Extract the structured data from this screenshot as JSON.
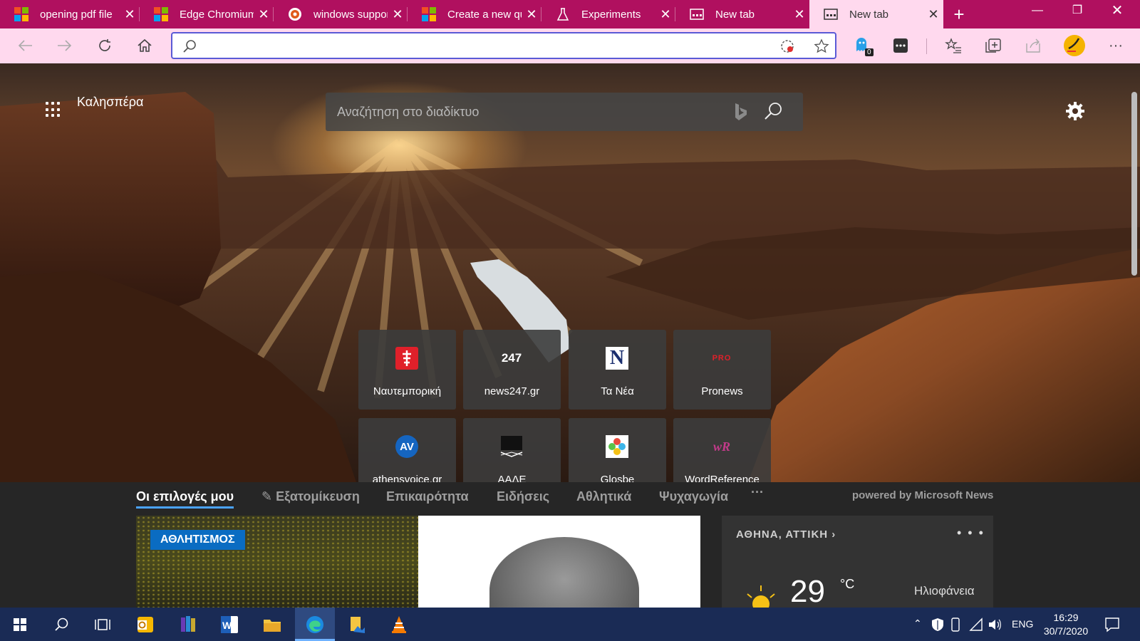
{
  "browser": {
    "tabs": [
      {
        "title": "opening pdf file",
        "icon": "microsoft-logo"
      },
      {
        "title": "Edge Chromium",
        "icon": "microsoft-logo"
      },
      {
        "title": "windows support",
        "icon": "support-site-icon"
      },
      {
        "title": "Create a new qu",
        "icon": "microsoft-logo"
      },
      {
        "title": "Experiments",
        "icon": "flask-icon"
      },
      {
        "title": "New tab",
        "icon": "newtab-icon"
      },
      {
        "title": "New tab",
        "icon": "newtab-icon",
        "active": true
      }
    ],
    "address": {
      "value": "",
      "placeholder": ""
    },
    "extension_badge": "0",
    "accent_color": "#b0105f",
    "toolbar_color": "#ffd9ee"
  },
  "ntp": {
    "greeting": "Καλησπέρα",
    "search_placeholder": "Αναζήτηση στο διαδίκτυο",
    "quick_links": [
      {
        "label": "Ναυτεμπορική",
        "icon": "naftemporiki-icon"
      },
      {
        "label": "news247.gr",
        "icon": "news247-icon",
        "icon_text": "247"
      },
      {
        "label": "Τα Νέα",
        "icon": "tanea-icon",
        "icon_text": "N"
      },
      {
        "label": "Pronews",
        "icon": "pronews-icon",
        "icon_text": "PRO"
      },
      {
        "label": "athensvoice.gr",
        "icon": "athensvoice-icon",
        "icon_text": "AV"
      },
      {
        "label": "ΑΑΔΕ",
        "icon": "aade-icon"
      },
      {
        "label": "Glosbe",
        "icon": "glosbe-icon"
      },
      {
        "label": "WordReference",
        "icon": "wordreference-icon",
        "icon_text": "wR"
      }
    ],
    "news_tabs": [
      {
        "label": "Οι επιλογές μου",
        "active": true
      },
      {
        "label": "Εξατομίκευση"
      },
      {
        "label": "Επικαιρότητα"
      },
      {
        "label": "Ειδήσεις"
      },
      {
        "label": "Αθλητικά"
      },
      {
        "label": "Ψυχαγωγία"
      },
      {
        "label": "···"
      }
    ],
    "powered_by": "powered by Microsoft News",
    "card_badge": "ΑΘΛΗΤΙΣΜΟΣ",
    "weather": {
      "location": "ΑΘΗΝΑ, ΑΤΤΙΚΗ",
      "temperature": "29",
      "unit": "°C",
      "condition": "Ηλιοφάνεια",
      "more": "• • •"
    }
  },
  "taskbar": {
    "apps": [
      "start-icon",
      "search-icon",
      "task-view-icon",
      "outlook-icon",
      "winrar-icon",
      "word-icon",
      "file-explorer-icon",
      "edge-icon",
      "photos-icon",
      "vlc-icon"
    ],
    "language": "ENG",
    "time": "16:29",
    "date": "30/7/2020"
  }
}
